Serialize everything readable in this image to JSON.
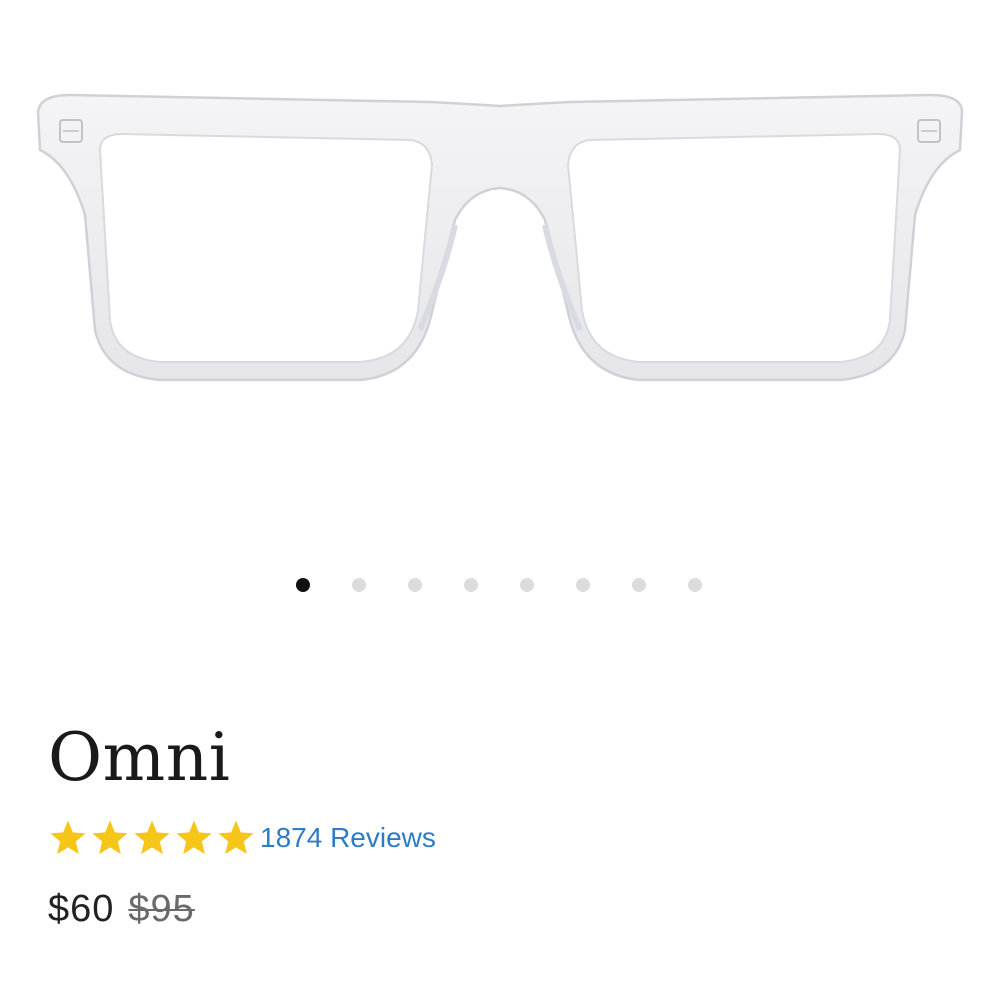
{
  "product": {
    "name": "Omni",
    "image_alt": "clear-frame-eyeglasses",
    "rating": {
      "stars": 5,
      "max_stars": 5,
      "star_color": "#f5c518",
      "reviews_label": "1874 Reviews"
    },
    "price": {
      "current": "$60",
      "original": "$95"
    }
  },
  "carousel": {
    "total_slides": 8,
    "active_index": 0,
    "active_color": "#111111",
    "inactive_color": "#dcdcdc"
  },
  "colors": {
    "link": "#2f7cc6",
    "text": "#1a1a1a"
  }
}
